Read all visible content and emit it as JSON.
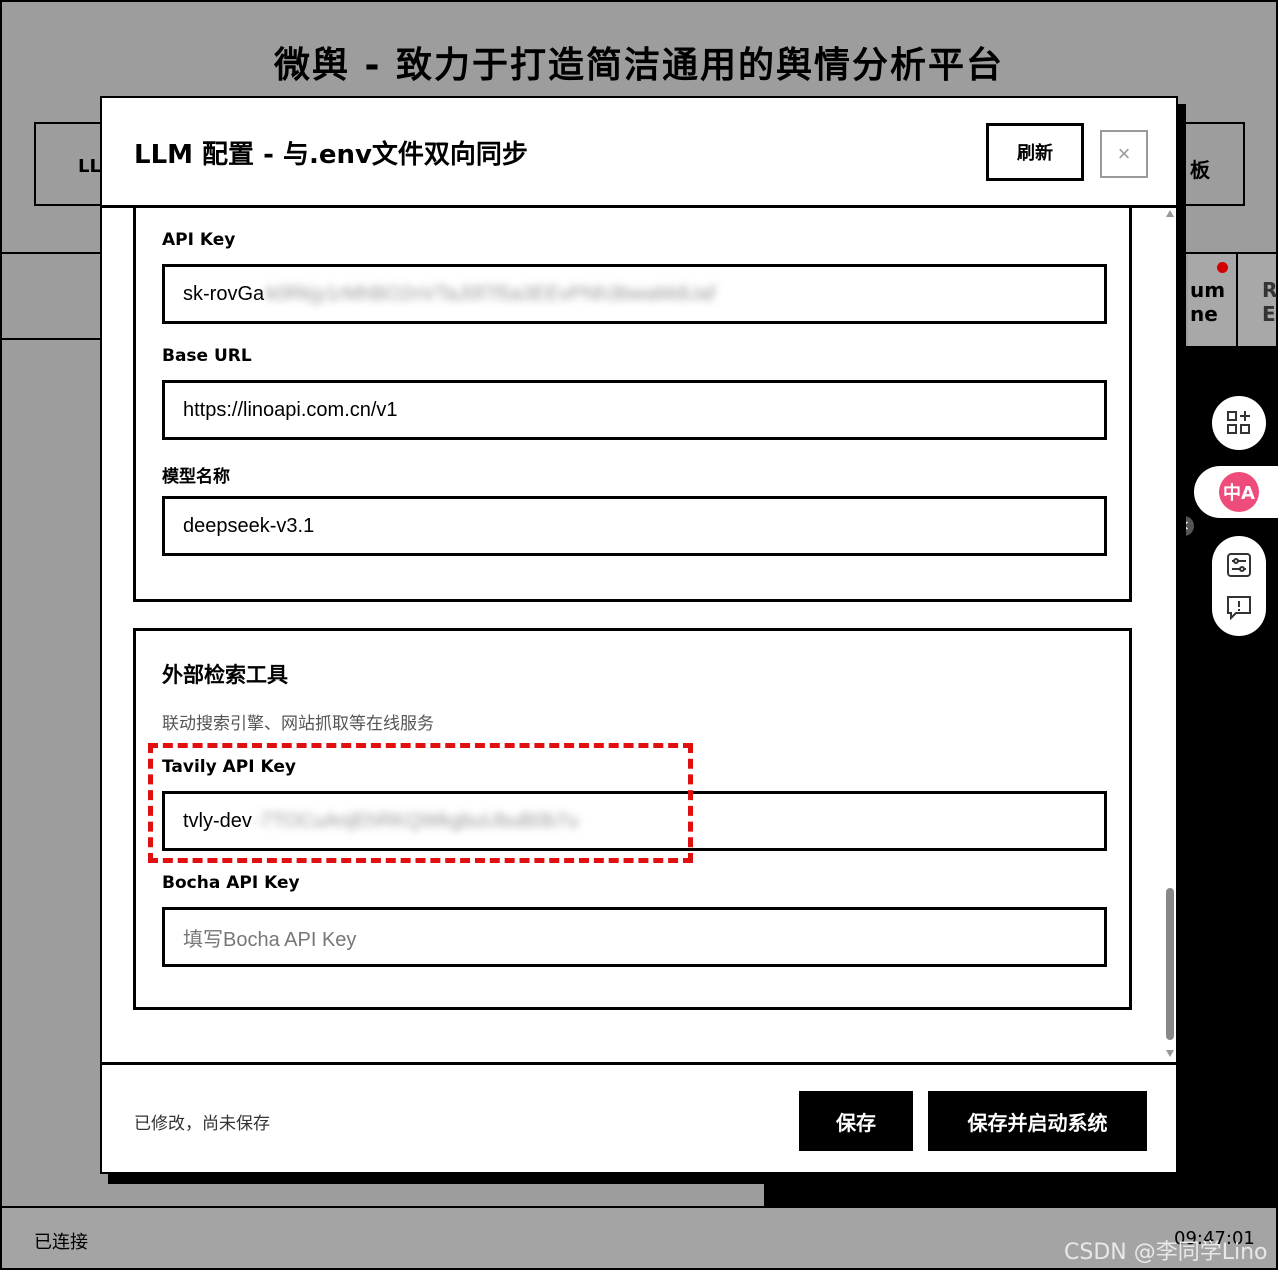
{
  "app": {
    "title": "微舆 - 致力于打造简洁通用的舆情分析平台",
    "left_tab_fragment": "LL",
    "right_tab_fragment": "板",
    "right_strip_line1": "um",
    "right_strip_line2": "ne",
    "right_strip_line3": "R",
    "right_strip_line4": "E"
  },
  "statusbar": {
    "connection": "已连接",
    "time": "09:47:01"
  },
  "watermark": "CSDN @李同学Lino",
  "side_tools": {
    "translate_label": "中A",
    "close_label": "×"
  },
  "modal": {
    "title": "LLM 配置 - 与.env文件双向同步",
    "refresh_label": "刷新",
    "close_label": "×",
    "llm_section": {
      "api_key_label": "API Key",
      "api_key_value": "sk-rovGa",
      "api_key_masked": "k0Rkjy1rMhBO2nVTaJ0f7l5a3EEvPNh3bwaMdUaf",
      "base_url_label": "Base URL",
      "base_url_value": "https://linoapi.com.cn/v1",
      "model_label": "模型名称",
      "model_value": "deepseek-v3.1"
    },
    "ext_section": {
      "title": "外部检索工具",
      "description": "联动搜索引擎、网站抓取等在线服务",
      "tavily_label": "Tavily API Key",
      "tavily_value": "tvly-dev",
      "tavily_masked": "-7TOCuAnjEhRKQWkgbuUbuB0b7u",
      "bocha_label": "Bocha API Key",
      "bocha_placeholder": "填写Bocha API Key"
    },
    "footer": {
      "status": "已修改，尚未保存",
      "save_label": "保存",
      "save_start_label": "保存并启动系统"
    }
  },
  "colors": {
    "highlight": "#e01010",
    "translate_accent": "#ee4d7c",
    "notification_dot": "#d40000"
  }
}
